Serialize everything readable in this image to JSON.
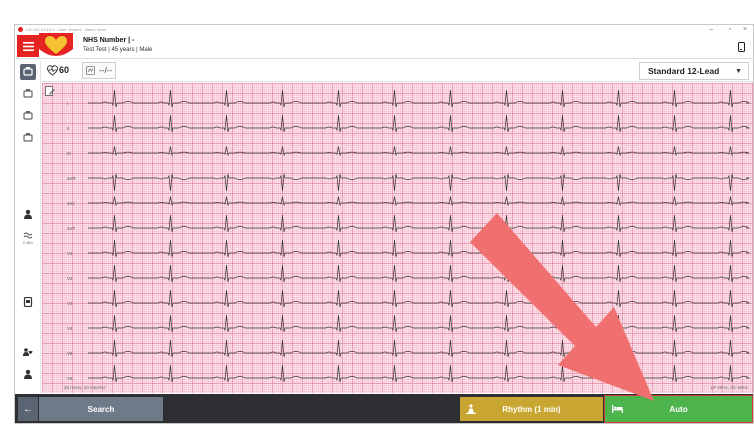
{
  "window": {
    "title": "CS-104 V4.10.0 · User: Nurse1 · Ward: None"
  },
  "header": {
    "nhs_label": "NHS Number | -",
    "patient_info": "Test Test | 45 years | Male"
  },
  "toolbar": {
    "heart_rate": "60",
    "blood_pressure": "--/--",
    "lead_select": "Standard 12-Lead"
  },
  "sidebar": {
    "sensor_label": "0 dB/s"
  },
  "ecg": {
    "leads": [
      "I",
      "II",
      "III",
      "aVR",
      "aVL",
      "aVF",
      "V1",
      "V2",
      "V3",
      "V4",
      "V5",
      "V6"
    ],
    "speed_note": "25 mm/s, 10 mm/mV",
    "filter_note": "LP 40Hz, AC 50Hz"
  },
  "bottombar": {
    "back_label": "←",
    "search_label": "Search",
    "rhythm_label": "Rhythm (1 min)",
    "auto_label": "Auto"
  },
  "colors": {
    "brand_red": "#e52421",
    "grid_pink": "#fde7ee",
    "rhythm_gold": "#c9a531",
    "auto_green": "#4db34d",
    "arrow_red": "#f07070"
  }
}
